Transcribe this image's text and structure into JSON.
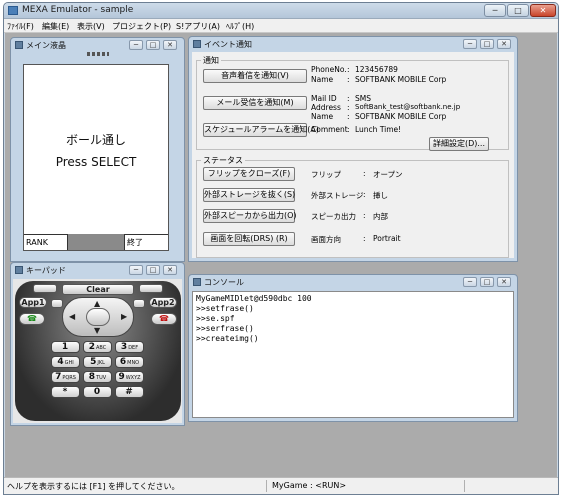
{
  "app": {
    "title": "MEXA Emulator - sample",
    "caption_buttons": {
      "minimize": "─",
      "maximize": "□",
      "close": "✕"
    }
  },
  "menu": [
    "ﾌｧｲﾙ(F)",
    "編集(E)",
    "表示(V)",
    "プロジェクト(P)",
    "S!アプリ(A)",
    "ﾍﾙﾌﾟ(H)"
  ],
  "child_caption_buttons": {
    "minimize": "─",
    "maximize": "□",
    "close": "✕"
  },
  "main_screen": {
    "title": "メイン液晶",
    "line1": "ボール通し",
    "line2": "Press SELECT",
    "softkey_left": "RANK",
    "softkey_right": "終了"
  },
  "keypad": {
    "title": "キーパッド",
    "clear": "Clear",
    "app1": "App1",
    "app2": "App2",
    "keys": [
      {
        "main": "1",
        "sub": ""
      },
      {
        "main": "2",
        "sub": "ABC"
      },
      {
        "main": "3",
        "sub": "DEF"
      },
      {
        "main": "4",
        "sub": "GHI"
      },
      {
        "main": "5",
        "sub": "JKL"
      },
      {
        "main": "6",
        "sub": "MNO"
      },
      {
        "main": "7",
        "sub": "PQRS"
      },
      {
        "main": "8",
        "sub": "TUV"
      },
      {
        "main": "9",
        "sub": "WXYZ"
      },
      {
        "main": "*",
        "sub": ""
      },
      {
        "main": "0",
        "sub": ""
      },
      {
        "main": "#",
        "sub": ""
      }
    ]
  },
  "event": {
    "title": "イベント通知",
    "notify_group": "通知",
    "btn_call": "音声着信を通知(V)",
    "btn_mail": "メール受信を通知(M)",
    "btn_alarm": "スケジュールアラームを通知(A)",
    "btn_detail": "詳細設定(D)...",
    "phone_label": "PhoneNo.",
    "phone_value": "123456789",
    "name_label": "Name",
    "name_value": "SOFTBANK MOBILE Corp",
    "mailid_label": "Mail ID",
    "mailid_value": "SMS",
    "address_label": "Address",
    "address_value": "SoftBank_test@softbank.ne.jp",
    "name2_label": "Name",
    "name2_value": "SOFTBANK MOBILE Corp",
    "comment_label": "Comment",
    "comment_value": "Lunch Time!",
    "colon": ":",
    "status_group": "ステータス",
    "btn_flip": "フリップをクローズ(F)",
    "btn_storage": "外部ストレージを抜く(S)",
    "btn_speaker": "外部スピーカから出力(O)",
    "btn_rotate": "画面を回転(DRS) (R)",
    "flip_label": "フリップ",
    "flip_value": "オープン",
    "storage_label": "外部ストレージ",
    "storage_value": "挿し",
    "speaker_label": "スピーカ出力",
    "speaker_value": "内部",
    "orientation_label": "画面方向",
    "orientation_value": "Portrait"
  },
  "console": {
    "title": "コンソール",
    "lines": [
      "MyGameMIDlet@d590dbc 100",
      ">>setfrase()",
      ">>se.spf",
      ">>serfrase()",
      ">>createimg()"
    ]
  },
  "statusbar": {
    "help": "ヘルプを表示するには [F1] を押してください。",
    "game": "MyGame : <RUN>"
  }
}
